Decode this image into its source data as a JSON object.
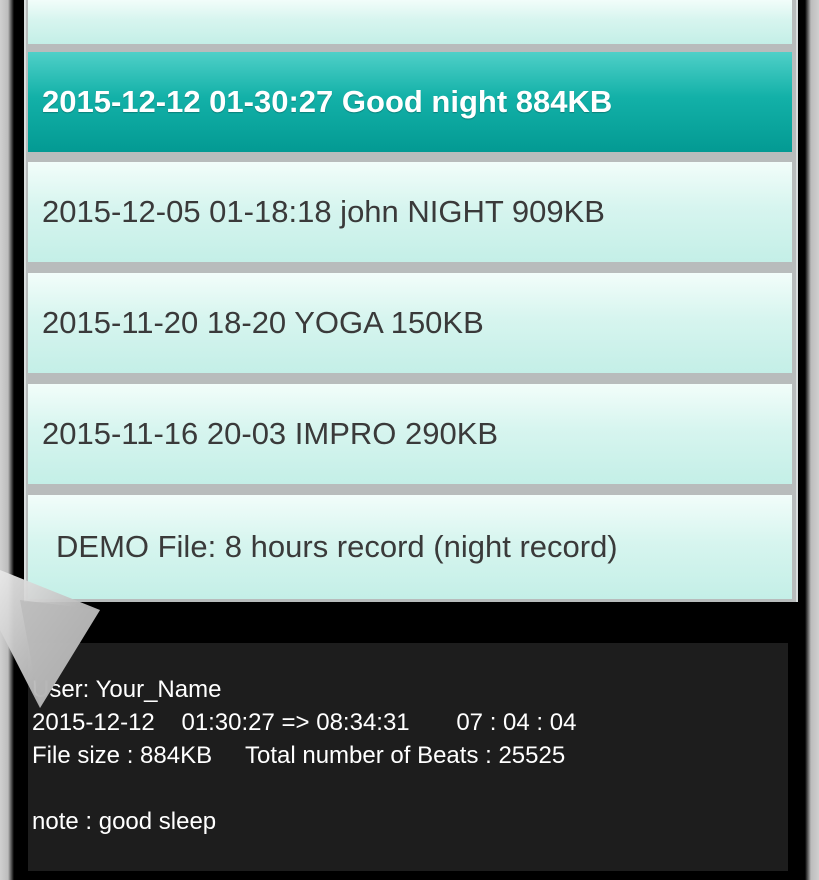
{
  "recordings": {
    "items": [
      {
        "label": ""
      },
      {
        "label": "2015-12-12 01-30:27 Good night  884KB",
        "selected": true
      },
      {
        "label": "2015-12-05 01-18:18 john NIGHT  909KB"
      },
      {
        "label": "2015-11-20 18-20 YOGA  150KB"
      },
      {
        "label": "2015-11-16 20-03 IMPRO  290KB"
      },
      {
        "label": "DEMO File: 8 hours record (night record)"
      }
    ]
  },
  "details": {
    "user_line": "User: Your_Name",
    "time_line": "2015-12-12    01:30:27 => 08:34:31       07 : 04 : 04",
    "size_line": "File size : 884KB     Total number of Beats : 25525",
    "note_line": "note : good sleep"
  },
  "colors": {
    "selected_row": "#039a93",
    "row_bg": "#d7f5ef",
    "info_bg": "#1d1d1d"
  }
}
